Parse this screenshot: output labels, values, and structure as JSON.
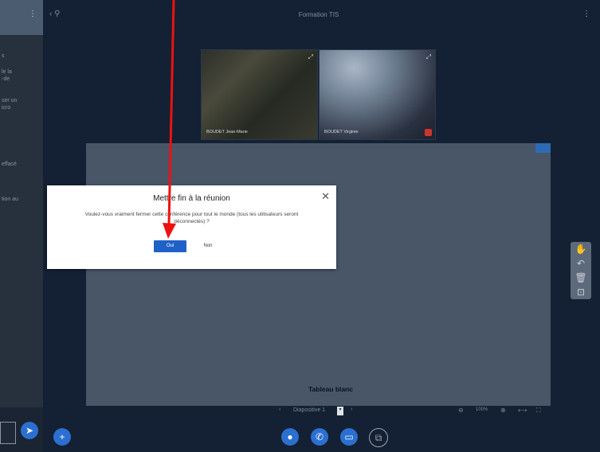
{
  "window": {
    "title": "Formation TIS"
  },
  "sidebar": {
    "menu_icon": "kebab-menu-icon",
    "back_icon": "people-back-icon",
    "text_fragments": [
      "s",
      "le la\n-de",
      "ser un\nicro",
      "effacé",
      "tion au"
    ]
  },
  "videos": [
    {
      "name": "BOUDET Jean-Marie",
      "expand_icon": "expand-icon",
      "muted": false
    },
    {
      "name": "BOUDET Virginie",
      "expand_icon": "expand-icon",
      "muted": true
    }
  ],
  "whiteboard": {
    "label": "Tableau blanc",
    "page": "Diapositive 1",
    "zoom": "100%"
  },
  "tools": [
    "hand-icon",
    "undo-icon",
    "trash-icon",
    "chart-icon"
  ],
  "bottom_bar": {
    "buttons": [
      "add-icon",
      "mic-icon",
      "phone-icon",
      "camera-icon",
      "screenshare-icon"
    ],
    "send_icon": "send-icon"
  },
  "dialog": {
    "title": "Mettre fin à la réunion",
    "message": "Voulez-vous vraiment fermer cette conférence pour tout le monde (tous les utilisateurs seront déconnectés) ?",
    "confirm_label": "Oui",
    "cancel_label": "Non",
    "close_icon": "close-icon"
  },
  "annotation": {
    "arrow_color": "#ee1111"
  },
  "colors": {
    "primary": "#2061c7",
    "background": "#142033"
  }
}
